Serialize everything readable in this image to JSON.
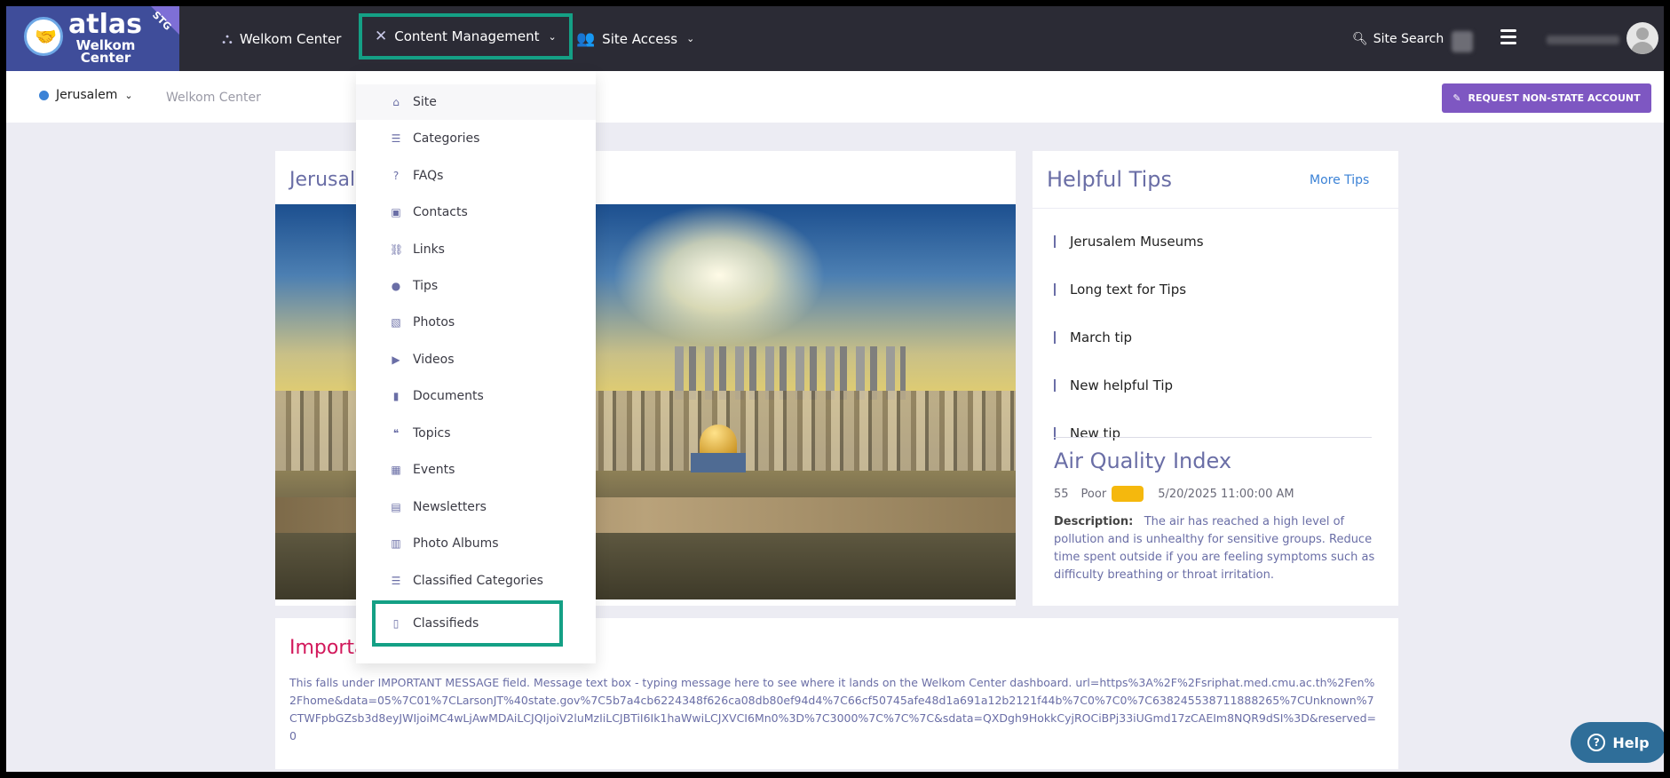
{
  "logo": {
    "brand": "atlas",
    "sub": "Welkom Center",
    "ribbon": "STG"
  },
  "nav": {
    "items": [
      {
        "label": "Welkom Center",
        "icon": "org-chart-icon"
      },
      {
        "label": "Content Management",
        "icon": "tools-icon"
      },
      {
        "label": "Site Access",
        "icon": "users-icon"
      }
    ],
    "search_label": "Site Search"
  },
  "subbar": {
    "location": "Jerusalem",
    "breadcrumb": "Welkom Center",
    "request_button": "REQUEST NON-STATE ACCOUNT"
  },
  "main": {
    "title": "Jerusalem"
  },
  "tips": {
    "title": "Helpful Tips",
    "more": "More Tips",
    "items": [
      "Jerusalem Museums",
      "Long text for Tips",
      "March tip",
      "New helpful Tip",
      "New tip"
    ]
  },
  "aqi": {
    "title": "Air Quality Index",
    "value": "55",
    "status": "Poor",
    "status_color": "#f5b80d",
    "timestamp": "5/20/2025 11:00:00 AM",
    "desc_label": "Description:",
    "desc": "The air has reached a high level of pollution and is unhealthy for sensitive groups. Reduce time spent outside if you are feeling symptoms such as difficulty breathing or throat irritation."
  },
  "important": {
    "title": "Important",
    "text": "This falls under IMPORTANT MESSAGE field. Message text box - typing message here to see where it lands on the Welkom Center dashboard. url=https%3A%2F%2Fsriphat.med.cmu.ac.th%2Fen%2Fhome&data=05%7C01%7CLarsonJT%40state.gov%7C5b7a4cb6224348f626ca08db80ef94d4%7C66cf50745afe48d1a691a12b2121f44b%7C0%7C0%7C638245538711888265%7CUnknown%7CTWFpbGZsb3d8eyJWIjoiMC4wLjAwMDAiLCJQIjoiV2luMzIiLCJBTiI6Ik1haWwiLCJXVCI6Mn0%3D%7C3000%7C%7C%7C&sdata=QXDgh9HokkCyjROCiBPj33iUGmd17zCAEIm8NQR9dSI%3D&reserved=0"
  },
  "dropdown": {
    "items": [
      {
        "label": "Site",
        "icon": "home-icon"
      },
      {
        "label": "Categories",
        "icon": "list-icon"
      },
      {
        "label": "FAQs",
        "icon": "question-icon"
      },
      {
        "label": "Contacts",
        "icon": "contact-icon"
      },
      {
        "label": "Links",
        "icon": "link-icon"
      },
      {
        "label": "Tips",
        "icon": "lightbulb-icon"
      },
      {
        "label": "Photos",
        "icon": "photos-icon"
      },
      {
        "label": "Videos",
        "icon": "video-icon"
      },
      {
        "label": "Documents",
        "icon": "document-icon"
      },
      {
        "label": "Topics",
        "icon": "comments-icon"
      },
      {
        "label": "Events",
        "icon": "calendar-icon"
      },
      {
        "label": "Newsletters",
        "icon": "newspaper-icon"
      },
      {
        "label": "Photo Albums",
        "icon": "book-icon"
      },
      {
        "label": "Classified Categories",
        "icon": "list-icon"
      },
      {
        "label": "Classifieds",
        "icon": "clipboard-icon"
      }
    ]
  },
  "help": {
    "label": "Help"
  },
  "colors": {
    "nav_bg": "#2b2b35",
    "accent": "#7e57c2",
    "highlight": "#14a085",
    "title": "#6a6ea6",
    "important": "#d2185b"
  }
}
